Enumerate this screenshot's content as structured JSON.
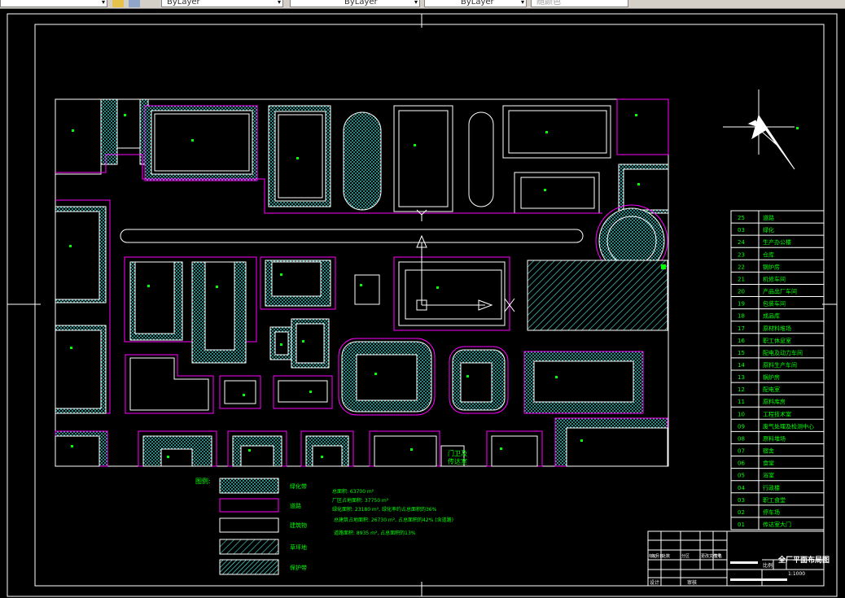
{
  "toolbar": {
    "layer_dropdown_arrow": "▾",
    "color_control": "ByLayer",
    "linetype_control": "ByLayer",
    "lineweight_control": "ByLayer",
    "plotstyle_control": "随颜色"
  },
  "legend": {
    "title": "图例:",
    "items": [
      "绿化带",
      "道路",
      "建筑物",
      "草坪地",
      "保护带"
    ]
  },
  "stats": [
    "总面积: 63700 m²",
    "厂区占地面积: 37750 m²",
    "绿化面积: 23180 m², 绿化率约占总面积的36%",
    "总建筑占地面积: 26730 m², 占总面积的42% (含道路)",
    "道路面积: 8935 m², 占总面积的13%"
  ],
  "table_rows": [
    {
      "no": "25",
      "name": "道路"
    },
    {
      "no": "03",
      "name": "绿化"
    },
    {
      "no": "24",
      "name": "生产办公楼"
    },
    {
      "no": "23",
      "name": "仓库"
    },
    {
      "no": "22",
      "name": "锅炉房"
    },
    {
      "no": "21",
      "name": "机修车间"
    },
    {
      "no": "20",
      "name": "产品出厂车间"
    },
    {
      "no": "19",
      "name": "包装车间"
    },
    {
      "no": "18",
      "name": "成品库"
    },
    {
      "no": "17",
      "name": "原材料堆场"
    },
    {
      "no": "16",
      "name": "职工休息室"
    },
    {
      "no": "15",
      "name": "配电及动力车间"
    },
    {
      "no": "14",
      "name": "原料生产车间"
    },
    {
      "no": "13",
      "name": "锅炉房"
    },
    {
      "no": "12",
      "name": "配电室"
    },
    {
      "no": "11",
      "name": "原料库房"
    },
    {
      "no": "10",
      "name": "工程技术室"
    },
    {
      "no": "09",
      "name": "废气处理及检测中心"
    },
    {
      "no": "08",
      "name": "原料堆场"
    },
    {
      "no": "07",
      "name": "宿舍"
    },
    {
      "no": "06",
      "name": "食堂"
    },
    {
      "no": "05",
      "name": "浴室"
    },
    {
      "no": "04",
      "name": "行政楼"
    },
    {
      "no": "03",
      "name": "职工食堂"
    },
    {
      "no": "02",
      "name": "停车场"
    },
    {
      "no": "01",
      "name": "传达室大门"
    }
  ],
  "title_block": {
    "drawing_title": "全厂平面布局图",
    "design_label": "设计",
    "check_label": "审核",
    "scale_label": "比例",
    "scale_value": "1:1000",
    "row_labels": [
      "标记",
      "处数",
      "分区",
      "更改文件号",
      "签名",
      "年月日"
    ]
  },
  "gate_labels": [
    "门卫及",
    "传达室"
  ],
  "colors": {
    "background": "#000000",
    "line_white": "#ffffff",
    "line_magenta": "#ff00ff",
    "hatch_cyan": "#4ee8e0",
    "text_green": "#00ff00"
  }
}
